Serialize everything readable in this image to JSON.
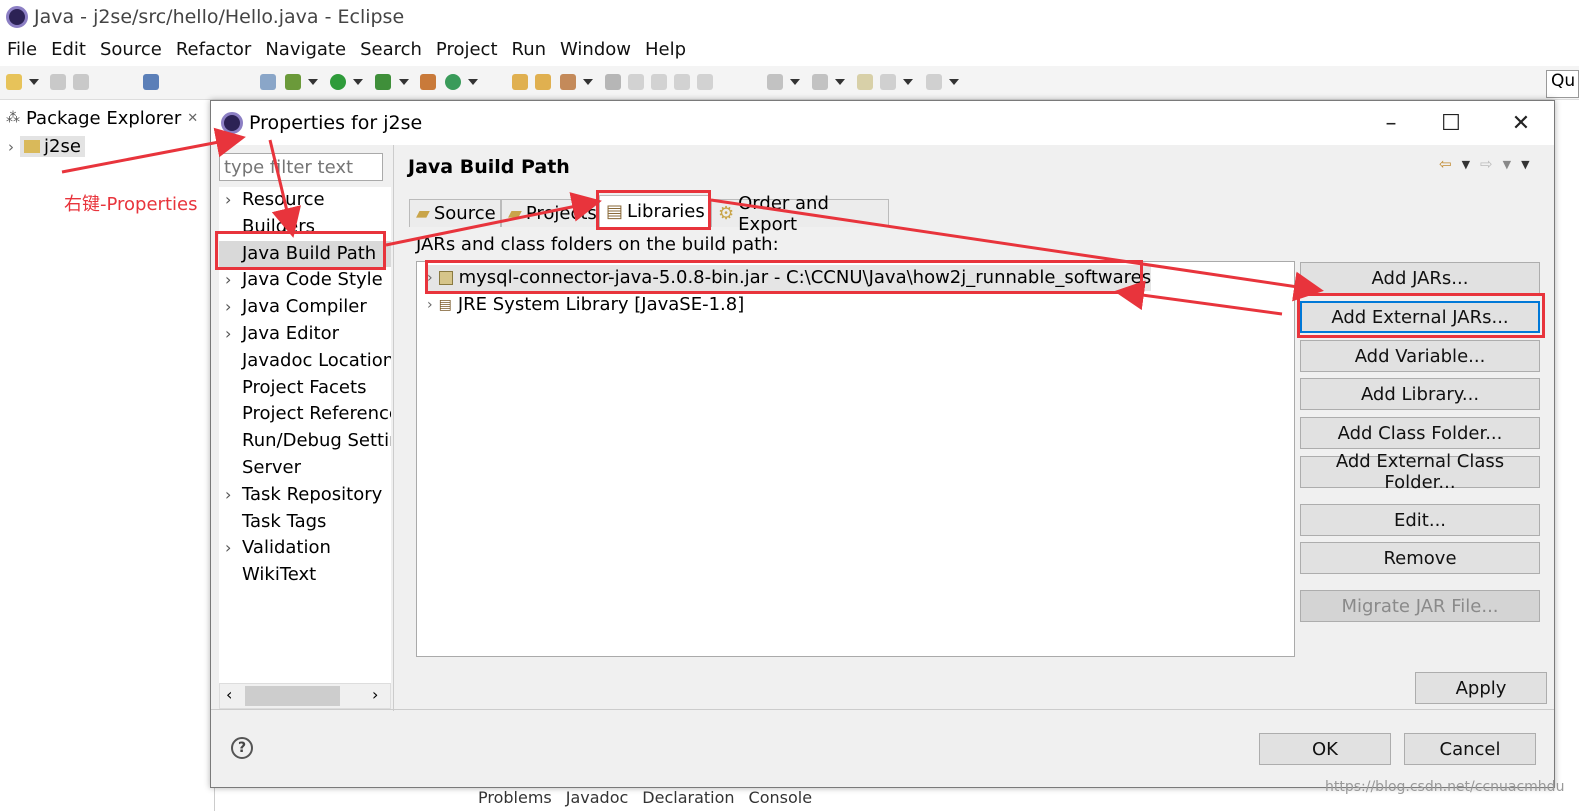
{
  "window": {
    "title": "Java - j2se/src/hello/Hello.java - Eclipse"
  },
  "menu": [
    "File",
    "Edit",
    "Source",
    "Refactor",
    "Navigate",
    "Search",
    "Project",
    "Run",
    "Window",
    "Help"
  ],
  "quick_access": "Qu",
  "package_explorer": {
    "tab_label": "Package Explorer",
    "project": "j2se"
  },
  "dialog": {
    "title": "Properties for j2se",
    "filter_placeholder": "type filter text",
    "nav_items": [
      {
        "label": "Resource",
        "expandable": true
      },
      {
        "label": "Builders",
        "expandable": false
      },
      {
        "label": "Java Build Path",
        "expandable": false,
        "selected": true
      },
      {
        "label": "Java Code Style",
        "expandable": true
      },
      {
        "label": "Java Compiler",
        "expandable": true
      },
      {
        "label": "Java Editor",
        "expandable": true
      },
      {
        "label": "Javadoc Location",
        "expandable": false
      },
      {
        "label": "Project Facets",
        "expandable": false
      },
      {
        "label": "Project References",
        "expandable": false
      },
      {
        "label": "Run/Debug Settings",
        "expandable": false
      },
      {
        "label": "Server",
        "expandable": false
      },
      {
        "label": "Task Repository",
        "expandable": true
      },
      {
        "label": "Task Tags",
        "expandable": false
      },
      {
        "label": "Validation",
        "expandable": true
      },
      {
        "label": "WikiText",
        "expandable": false
      }
    ],
    "page_title": "Java Build Path",
    "tabs": [
      "Source",
      "Projects",
      "Libraries",
      "Order and Export"
    ],
    "active_tab": "Libraries",
    "build_path_label": "JARs and class folders on the build path:",
    "libraries": [
      "mysql-connector-java-5.0.8-bin.jar - C:\\CCNU\\Java\\how2j_runnable_softwares",
      "JRE System Library [JavaSE-1.8]"
    ],
    "buttons": {
      "add_jars": "Add JARs...",
      "add_external_jars": "Add External JARs...",
      "add_variable": "Add Variable...",
      "add_library": "Add Library...",
      "add_class_folder": "Add Class Folder...",
      "add_external_class_folder": "Add External Class Folder...",
      "edit": "Edit...",
      "remove": "Remove",
      "migrate_jar": "Migrate JAR File...",
      "apply": "Apply",
      "ok": "OK",
      "cancel": "Cancel"
    }
  },
  "annotation": {
    "text": "右键-Properties",
    "color": "#e8343c"
  },
  "background_tabs": [
    "Problems",
    "Javadoc",
    "Declaration",
    "Console"
  ],
  "watermark": "https://blog.csdn.net/ccnuacmhdu"
}
